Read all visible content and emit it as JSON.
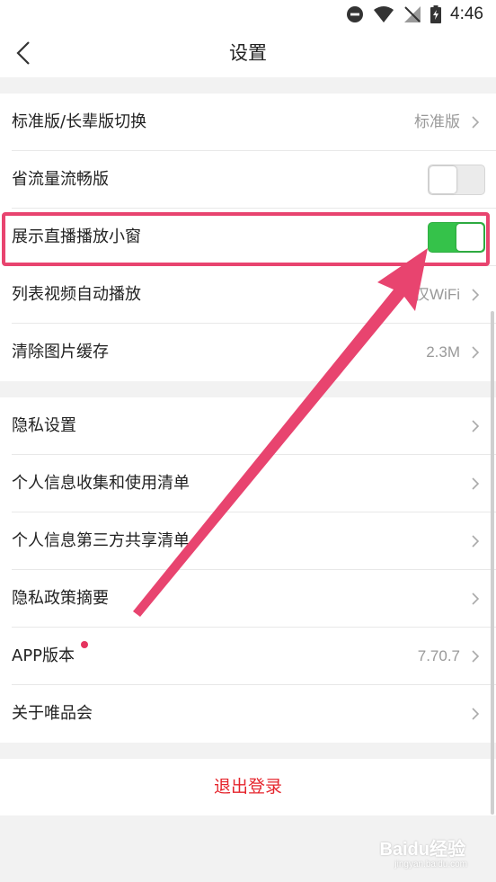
{
  "status_bar": {
    "time": "4:46",
    "icons": [
      "do-not-disturb-icon",
      "wifi-icon",
      "no-signal-icon",
      "battery-charging-icon"
    ]
  },
  "nav": {
    "title": "设置",
    "back_icon": "chevron-left-icon"
  },
  "group1": [
    {
      "label": "标准版/长辈版切换",
      "value": "标准版",
      "control": "chevron"
    },
    {
      "label": "省流量流畅版",
      "control": "toggle",
      "on": false
    },
    {
      "label": "展示直播播放小窗",
      "control": "toggle",
      "on": true
    },
    {
      "label": "列表视频自动播放",
      "value": "仅WiFi",
      "control": "chevron"
    },
    {
      "label": "清除图片缓存",
      "value": "2.3M",
      "control": "chevron"
    }
  ],
  "group2": [
    {
      "label": "隐私设置",
      "control": "chevron"
    },
    {
      "label": "个人信息收集和使用清单",
      "control": "chevron"
    },
    {
      "label": "个人信息第三方共享清单",
      "control": "chevron"
    },
    {
      "label": "隐私政策摘要",
      "control": "chevron"
    },
    {
      "label": "APP版本",
      "value": "7.70.7",
      "control": "chevron",
      "badge": true
    },
    {
      "label": "关于唯品会",
      "control": "chevron"
    }
  ],
  "logout_label": "退出登录",
  "watermark": {
    "text": "Baidu经验",
    "url": "jingyan.baidu.com"
  },
  "colors": {
    "toggle_on": "#35c24a",
    "logout_text": "#e5242c",
    "annotation": "#e8446f",
    "background": "#f2f2f2"
  }
}
